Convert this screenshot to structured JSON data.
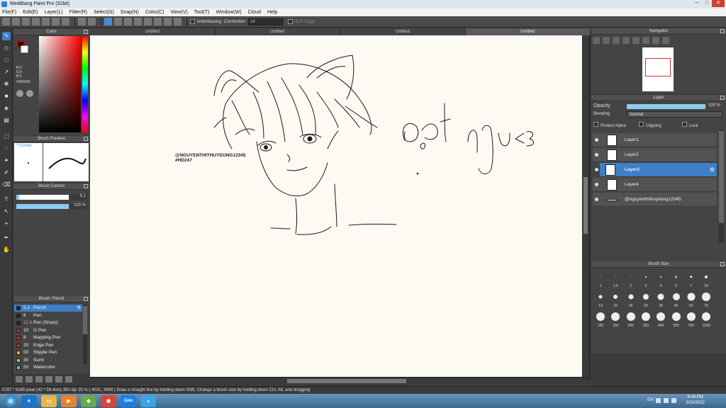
{
  "window": {
    "title": "MediBang Paint Pro (32bit)"
  },
  "menu": [
    "File(F)",
    "Edit(E)",
    "Layer(L)",
    "Filter(R)",
    "Select(S)",
    "Snap(N)",
    "Color(C)",
    "View(V)",
    "Tool(T)",
    "Window(W)",
    "Cloud",
    "Help"
  ],
  "toolbar": {
    "antialiasing_label": "AntiAliasing",
    "correction_label": "Correction",
    "correction_value": "14",
    "soft_edge_label": "Soft Edge"
  },
  "tabs": [
    "Untitled",
    "Untitled",
    "Untitled",
    "Untitled"
  ],
  "color_panel": {
    "title": "Color",
    "r": "R:0",
    "g": "G:0",
    "b": "B:0",
    "hex": "#000000",
    "foreground": "#111111",
    "background": "#ffffff"
  },
  "brush_preview": {
    "title": "Brush Preview",
    "size": "* 0.37mm"
  },
  "brush_control": {
    "title": "Brush Control",
    "size_value": "5.1",
    "opacity_value": "100 %",
    "size_fraction": 0.05,
    "opacity_fraction": 1.0
  },
  "brush_list": {
    "title": "Brush: Pencil",
    "items": [
      {
        "size": "5.1",
        "name": "Pencil",
        "color": "#222222"
      },
      {
        "size": "8",
        "name": "Pen",
        "color": "#222222"
      },
      {
        "size": "11.6",
        "name": "Pen (Sharp)",
        "color": "#222222"
      },
      {
        "size": "10",
        "name": "G Pen",
        "color": "#d32020"
      },
      {
        "size": "8",
        "name": "Mapping Pen",
        "color": "#d32020"
      },
      {
        "size": "20",
        "name": "Edge Pen",
        "color": "#d32020"
      },
      {
        "size": "50",
        "name": "Stipple Pen",
        "color": "#e8b020"
      },
      {
        "size": "30",
        "name": "Sumi",
        "color": "#e8b020"
      },
      {
        "size": "50",
        "name": "Watercolor",
        "color": "#5ec0f0"
      }
    ]
  },
  "canvas": {
    "watermark_line1": "@NGUYENTHITHUYDUNG12345",
    "watermark_line2": "#HD247"
  },
  "navigator": {
    "title": "Navigator"
  },
  "layer_panel": {
    "title": "Layer",
    "opacity_label": "Opacity",
    "opacity_value": "100 %",
    "blending_label": "Blending",
    "blending_value": "Normal",
    "protect_alpha": "Protect Alpha",
    "clipping": "Clipping",
    "lock": "Lock",
    "layers": [
      "Layer1",
      "Layer2",
      "Layer3",
      "Layer4",
      "@nguyenthithuydung12345"
    ]
  },
  "brush_size_panel": {
    "title": "Brush Size",
    "sizes": [
      "1",
      "1.5",
      "2",
      "3",
      "4",
      "5",
      "7",
      "10",
      "13",
      "15",
      "20",
      "25",
      "30",
      "40",
      "50",
      "70",
      "100",
      "150",
      "200",
      "300",
      "400",
      "500",
      "700",
      "1000"
    ]
  },
  "status": "5787 * 8185 pixel   (42 * 59.4cm)   350 dpi   25 %   ( 4031, 3499 )   Draw a straight line by holding down Shift, Change a brush size by holding down Ctrl, Alt, and dragging",
  "taskbar": {
    "lang": "EN",
    "time": "9:04 PM",
    "date": "2/23/2022",
    "zalo": "Zalo"
  }
}
